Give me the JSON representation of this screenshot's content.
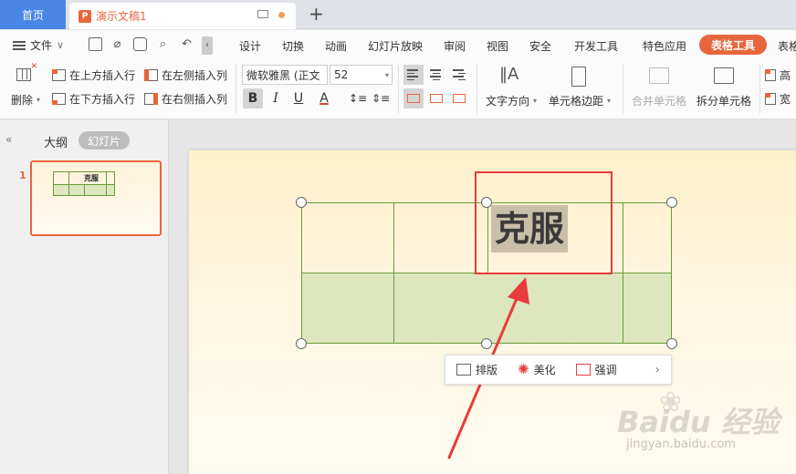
{
  "tabs": {
    "home": "首页",
    "doc_title": "演示文稿1",
    "doc_icon_letter": "P"
  },
  "menu": {
    "file": "文件",
    "items": [
      "设计",
      "切换",
      "动画",
      "幻灯片放映",
      "审阅",
      "视图",
      "安全",
      "开发工具",
      "特色应用",
      "表格工具",
      "表格"
    ],
    "active_label": "表格工具"
  },
  "ribbon": {
    "delete": "删除",
    "insert_above": "在上方插入行",
    "insert_below": "在下方插入行",
    "insert_left": "在左侧插入列",
    "insert_right": "在右侧插入列",
    "font_name": "微软雅黑 (正文",
    "font_size": "52",
    "text_direction": "文字方向",
    "cell_margin": "单元格边距",
    "merge_cells": "合并单元格",
    "split_cells": "拆分单元格",
    "height": "高",
    "width": "宽"
  },
  "left_pane": {
    "outline": "大纲",
    "slides": "幻灯片",
    "slide_number": "1",
    "thumb_text": "克服"
  },
  "slide": {
    "cell_text": "克服"
  },
  "float_bar": {
    "layout": "排版",
    "beautify": "美化",
    "emphasize": "强调"
  },
  "watermark": {
    "logo": "Baidu 经验",
    "url": "jingyan.baidu.com"
  },
  "colors": {
    "accent": "#e8663d",
    "home_tab": "#4a86e8",
    "table_border": "#6a9a3a",
    "table_fill": "#dde6bf",
    "highlight_box": "#e93b3b"
  }
}
